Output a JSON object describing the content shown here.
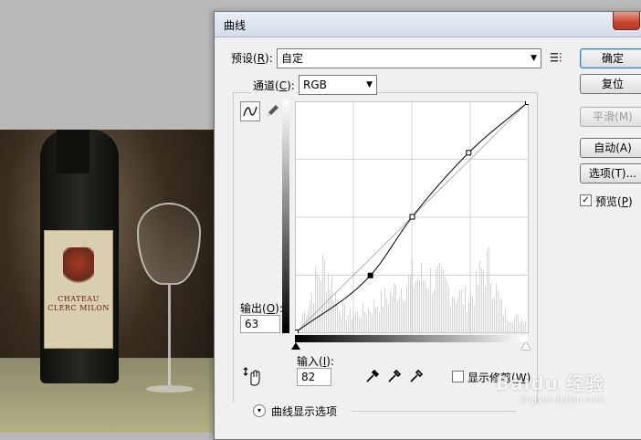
{
  "dialog": {
    "title": "曲线",
    "preset": {
      "label_prefix": "预设(",
      "hotkey": "R",
      "label_suffix": "):",
      "value": "自定"
    },
    "channel": {
      "label_prefix": "通道(",
      "hotkey": "C",
      "label_suffix": "):",
      "value": "RGB"
    },
    "buttons": {
      "ok": "确定",
      "reset": "复位",
      "smooth": "平滑(M)",
      "auto": "自动(A)",
      "options": "选项(T)..."
    },
    "preview": {
      "label_prefix": "预览(",
      "hotkey": "P",
      "label_suffix": ")",
      "checked": true
    },
    "output": {
      "label_prefix": "输出(",
      "hotkey": "O",
      "label_suffix": "):",
      "value": "63"
    },
    "input": {
      "label_prefix": "输入(",
      "hotkey": "I",
      "label_suffix": "):",
      "value": "82"
    },
    "show_clipping": {
      "label_prefix": "显示修剪(",
      "hotkey": "W",
      "label_suffix": ")",
      "checked": false
    },
    "curve_display_options": "曲线显示选项"
  },
  "curve": {
    "control_points": [
      [
        0,
        0
      ],
      [
        82,
        63
      ],
      [
        128,
        128
      ],
      [
        190,
        199
      ],
      [
        255,
        255
      ]
    ],
    "selected_point_index": 1
  },
  "photo": {
    "label_text": "CHATEAU CLERC MILON"
  },
  "watermark": {
    "brand": "Baidu 经验",
    "sub": "jingyan.baidu.com"
  }
}
